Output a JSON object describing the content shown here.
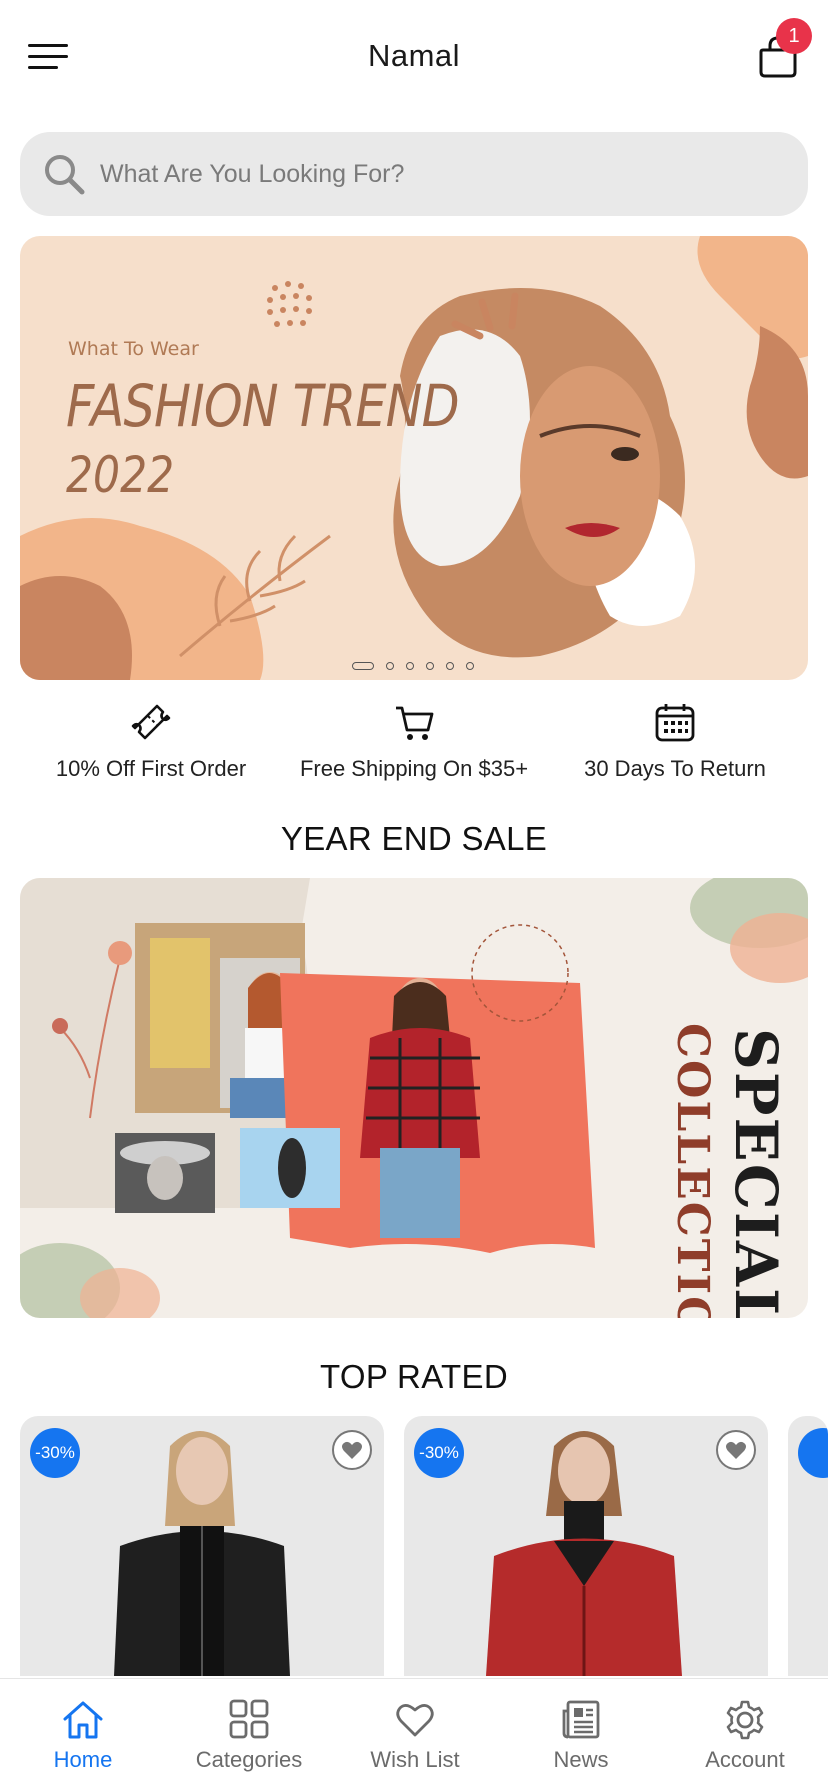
{
  "header": {
    "title": "Namal",
    "cart_count": "1",
    "menu_icon": "hamburger-menu-icon",
    "cart_icon": "shopping-bag-icon"
  },
  "search": {
    "placeholder": "What Are You Looking For?",
    "value": "",
    "icon": "search-icon"
  },
  "hero_banner": {
    "kicker": "What To Wear",
    "title": "FASHION TREND",
    "year": "2022",
    "slide_count": 6,
    "active_slide": 1
  },
  "perks": [
    {
      "icon": "ticket-icon",
      "label": "10% Off First Order"
    },
    {
      "icon": "cart-icon",
      "label": "Free Shipping On $35+"
    },
    {
      "icon": "calendar-icon",
      "label": "30 Days To Return"
    }
  ],
  "sale_section": {
    "title": "YEAR END SALE",
    "banner_text_1": "SPECIAL",
    "banner_text_2": "COLLECTION"
  },
  "top_rated": {
    "title": "TOP RATED",
    "products": [
      {
        "discount": "-30%",
        "image": "woman in black leather jacket"
      },
      {
        "discount": "-30%",
        "image": "woman in red leather jacket"
      }
    ]
  },
  "tabbar": {
    "items": [
      {
        "label": "Home",
        "icon": "home-icon",
        "active": true
      },
      {
        "label": "Categories",
        "icon": "grid-icon",
        "active": false
      },
      {
        "label": "Wish List",
        "icon": "heart-icon",
        "active": false
      },
      {
        "label": "News",
        "icon": "newspaper-icon",
        "active": false
      },
      {
        "label": "Account",
        "icon": "gear-icon",
        "active": false
      }
    ]
  },
  "colors": {
    "accent": "#1575f0",
    "badge": "#e8334a",
    "hero_bg": "#f6dfcb",
    "hero_text": "#9e6a4b"
  }
}
